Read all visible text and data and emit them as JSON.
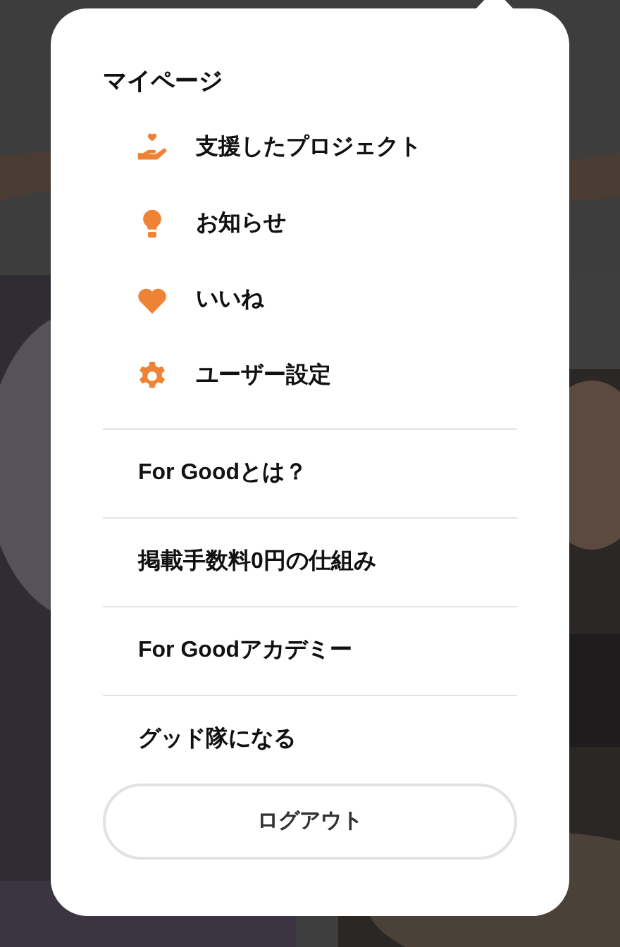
{
  "menu": {
    "heading": "マイページ",
    "mypage_items": [
      {
        "label": "支援したプロジェクト"
      },
      {
        "label": "お知らせ"
      },
      {
        "label": "いいね"
      },
      {
        "label": "ユーザー設定"
      }
    ],
    "links": [
      "For Goodとは？",
      "掲載手数料0円の仕組み",
      "For Goodアカデミー",
      "グッド隊になる"
    ],
    "logout_button": "ログアウト"
  }
}
